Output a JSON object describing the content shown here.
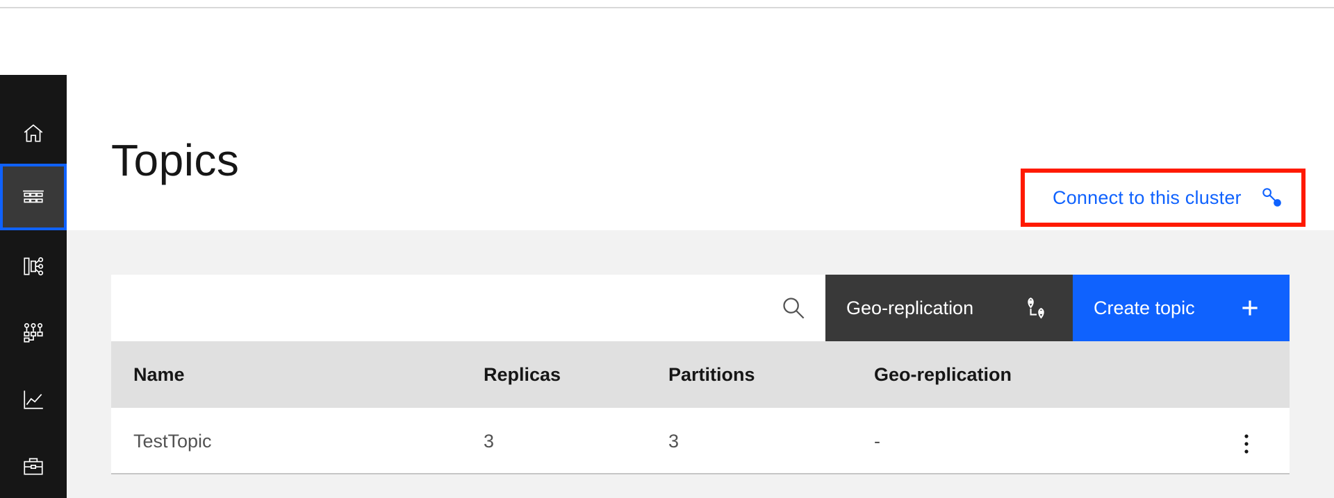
{
  "page": {
    "title": "Topics"
  },
  "sidebar": {
    "items": [
      {
        "name": "home",
        "icon": "home-icon"
      },
      {
        "name": "topics",
        "icon": "topics-icon",
        "active": true
      },
      {
        "name": "schemas",
        "icon": "schema-icon"
      },
      {
        "name": "consumer-groups",
        "icon": "consumer-groups-icon"
      },
      {
        "name": "monitoring",
        "icon": "chart-line-icon"
      },
      {
        "name": "toolbox",
        "icon": "toolbox-icon"
      }
    ]
  },
  "header": {
    "connect_label": "Connect to this cluster",
    "connect_icon": "connect-icon"
  },
  "toolbar": {
    "search_placeholder": "",
    "geo_label": "Geo-replication",
    "geo_icon": "geo-replication-icon",
    "create_label": "Create topic",
    "create_icon": "add-icon"
  },
  "table": {
    "columns": [
      "Name",
      "Replicas",
      "Partitions",
      "Geo-replication"
    ],
    "rows": [
      {
        "name": "TestTopic",
        "replicas": "3",
        "partitions": "3",
        "geo": "-"
      }
    ]
  },
  "colors": {
    "accent": "#0f62fe",
    "sidebar_bg": "#161616",
    "highlight_outline": "#ff1a00",
    "geo_button_bg": "#393939"
  }
}
